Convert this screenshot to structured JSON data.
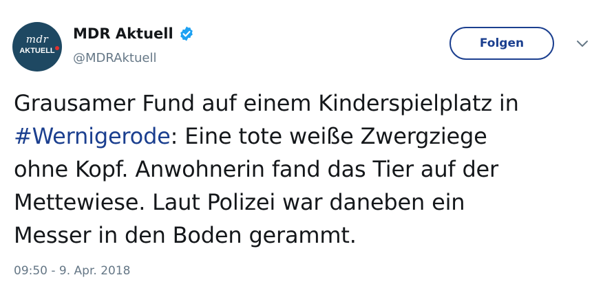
{
  "account": {
    "display_name": "MDR Aktuell",
    "handle": "@MDRAktuell",
    "verified": true,
    "avatar_logo_top": "mdr",
    "avatar_logo_bottom": "AKTUELL"
  },
  "actions": {
    "follow_label": "Folgen"
  },
  "tweet": {
    "line1": "Grausamer Fund auf einem Kinderspielplatz in",
    "hashtag": "#Wernigerode",
    "line2_rest": ": Eine tote weiße Zwergziege",
    "line3": "ohne Kopf. Anwohnerin fand das Tier auf der",
    "line4": "Mettewiese. Laut Polizei war daneben ein",
    "line5": "Messer in den Boden gerammt.",
    "timestamp": "09:50 - 9. Apr. 2018"
  },
  "colors": {
    "link": "#1b3f8f",
    "verified_badge": "#1da1f2",
    "avatar_bg": "#1e4862",
    "muted_text": "#657786"
  },
  "icons": {
    "verified": "verified-badge-icon",
    "menu": "chevron-down-icon"
  }
}
